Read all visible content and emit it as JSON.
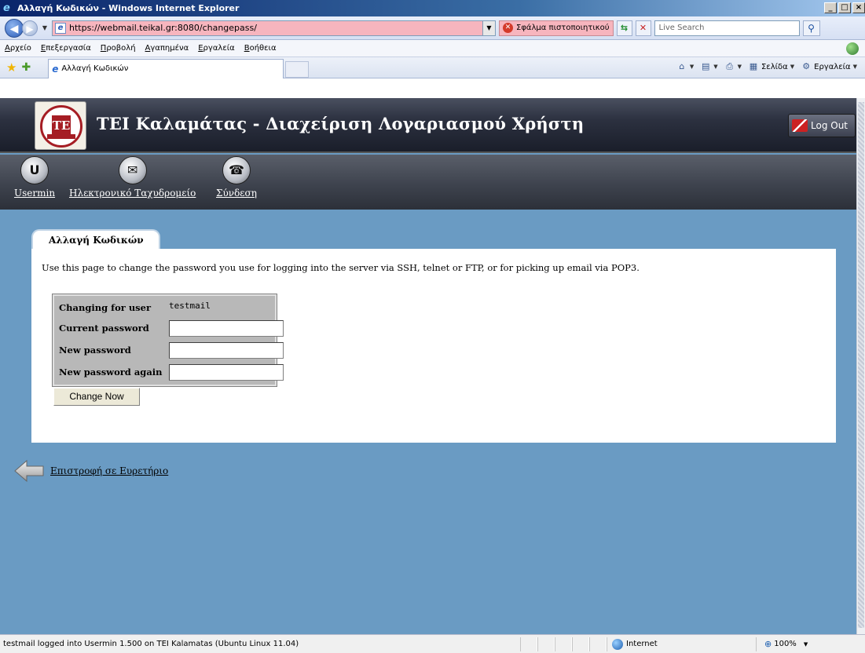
{
  "window": {
    "title": "Αλλαγή Κωδικών - Windows Internet Explorer"
  },
  "address": {
    "url": "https://webmail.teikal.gr:8080/changepass/",
    "cert_error": "Σφάλμα πιστοποιητικού",
    "search_placeholder": "Live Search"
  },
  "menu": {
    "items": [
      "Αρχείο",
      "Επεξεργασία",
      "Προβολή",
      "Αγαπημένα",
      "Εργαλεία",
      "Βοήθεια"
    ]
  },
  "tabs": {
    "active": "Αλλαγή Κωδικών"
  },
  "command_bar": {
    "page_label": "Σελίδα",
    "tools_label": "Εργαλεία"
  },
  "header": {
    "site_title": "ΤΕΙ Καλαμάτας - Διαχείριση Λογαριασμού Χρήστη",
    "logout_label": "Log Out"
  },
  "nav": {
    "items": [
      {
        "label": "Usermin",
        "icon": "usermin-icon"
      },
      {
        "label": "Ηλεκτρονικό Ταχυδρομείο",
        "icon": "mail-icon"
      },
      {
        "label": "Σύνδεση",
        "icon": "login-icon"
      }
    ]
  },
  "main": {
    "tab_title": "Αλλαγή Κωδικών",
    "intro": "Use this page to change the password you use for logging into the server via SSH, telnet or FTP, or for picking up email via POP3.",
    "form": {
      "user_label": "Changing for user",
      "user_value": "testmail",
      "current_label": "Current password",
      "current_value": "",
      "new_label": "New password",
      "new_value": "",
      "again_label": "New password again",
      "again_value": ""
    },
    "submit_label": "Change Now",
    "back_label": "Επιστροφή σε Ευρετήριο"
  },
  "status": {
    "text": "testmail logged into Usermin 1.500 on TEI Kalamatas (Ubuntu Linux 11.04)",
    "zone": "Internet",
    "zoom": "100%"
  }
}
